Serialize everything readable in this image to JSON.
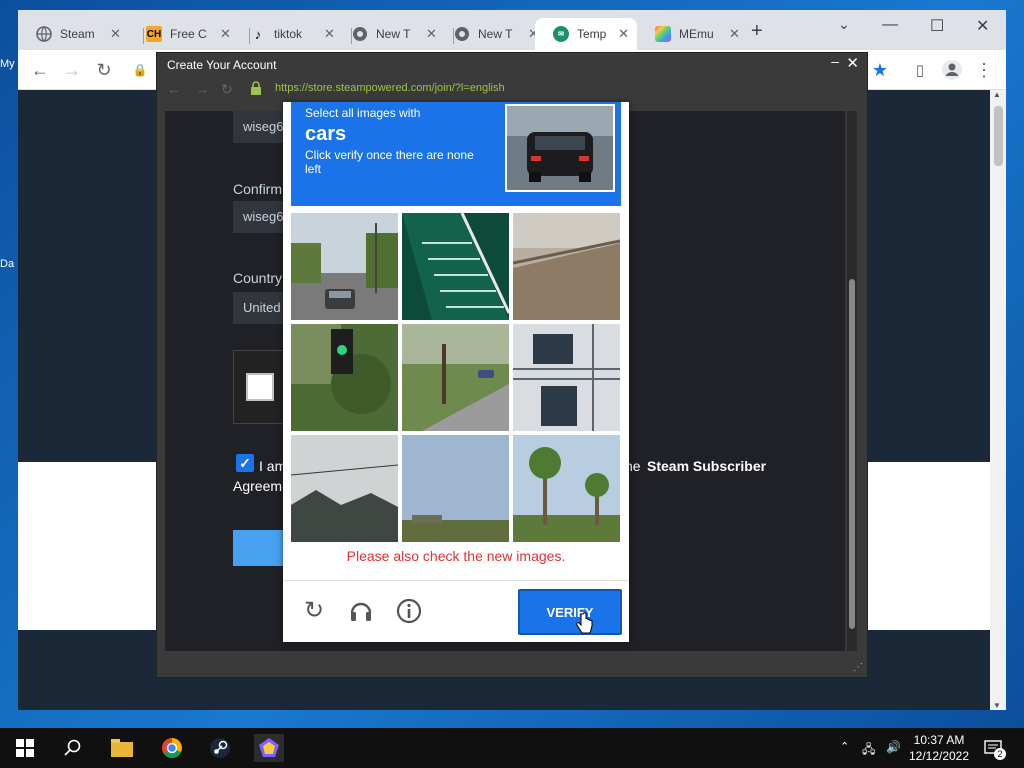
{
  "desktop": {
    "icon_labels": [
      "My",
      "Da"
    ]
  },
  "browser": {
    "tabs": [
      {
        "label": "Steam",
        "icon": "globe-icon",
        "fav_text": "",
        "fav_color": "#5f6368",
        "active": false
      },
      {
        "label": "Free C",
        "icon": "ch-logo-icon",
        "fav_text": "CH",
        "fav_color": "#f5a623",
        "active": false
      },
      {
        "label": "tiktok",
        "icon": "tiktok-icon",
        "fav_text": "♪",
        "fav_color": "#000000",
        "active": false
      },
      {
        "label": "New T",
        "icon": "chrome-icon",
        "fav_text": "",
        "fav_color": "#5f6368",
        "active": false
      },
      {
        "label": "New T",
        "icon": "chrome-icon",
        "fav_text": "",
        "fav_color": "#5f6368",
        "active": false
      },
      {
        "label": "Temp I",
        "icon": "temp-mail-icon",
        "fav_text": "",
        "fav_color": "#1e8e6e",
        "active": true
      },
      {
        "label": "MEmu",
        "icon": "memu-icon",
        "fav_text": "",
        "fav_color": "#7b61ff",
        "active": false
      }
    ],
    "new_tab": "+",
    "minimize": "—",
    "maximize": "☐",
    "close": "✕",
    "dropdown": "⌄"
  },
  "popup": {
    "title": "Create Your Account",
    "url": "https://store.steampowered.com/join/?l=english"
  },
  "form": {
    "email_value": "wiseg6",
    "confirm_label": "Confirm",
    "confirm_value": "wiseg6",
    "country_label": "Country",
    "country_value": "United",
    "agree_text_start": "I am",
    "agree_text_mid": "ne",
    "agree_link": "Steam Subscriber",
    "agree_text_line2": "Agreem"
  },
  "captcha": {
    "line1": "Select all images with",
    "line2": "cars",
    "line3": "Click verify once there are none left",
    "error": "Please also check the new images.",
    "verify_label": "VERIFY",
    "tiles": [
      {
        "name": "street-car"
      },
      {
        "name": "stairs"
      },
      {
        "name": "beach-sand"
      },
      {
        "name": "traffic-light"
      },
      {
        "name": "street-trees"
      },
      {
        "name": "fire-escape"
      },
      {
        "name": "rooftops"
      },
      {
        "name": "sky-grass"
      },
      {
        "name": "palm-trees"
      }
    ]
  },
  "taskbar": {
    "time": "10:37 AM",
    "date": "12/12/2022",
    "notifications": "2"
  }
}
